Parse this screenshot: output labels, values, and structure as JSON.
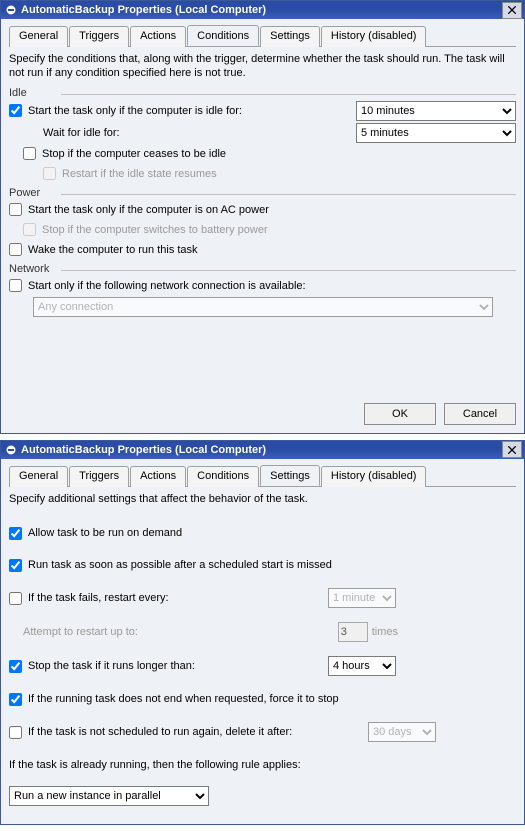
{
  "window1": {
    "title": "AutomaticBackup Properties (Local Computer)",
    "tabs": [
      "General",
      "Triggers",
      "Actions",
      "Conditions",
      "Settings",
      "History (disabled)"
    ],
    "active_tab": "Conditions",
    "intro": "Specify the conditions that, along with the trigger, determine whether the task should run.  The task will not run  if any condition specified here is not true.",
    "idle": {
      "group": "Idle",
      "start_idle": "Start the task only if the computer is idle for:",
      "start_idle_value": "10 minutes",
      "wait_idle": "Wait for idle for:",
      "wait_idle_value": "5 minutes",
      "stop_cease": "Stop if the computer ceases to be idle",
      "restart_resume": "Restart if the idle state resumes"
    },
    "power": {
      "group": "Power",
      "ac": "Start the task only if the computer is on AC power",
      "stop_batt": "Stop if the computer switches to battery power",
      "wake": "Wake the computer to run this task"
    },
    "network": {
      "group": "Network",
      "start_net": "Start only if the following network connection is available:",
      "any": "Any connection"
    },
    "buttons": {
      "ok": "OK",
      "cancel": "Cancel"
    }
  },
  "window2": {
    "title": "AutomaticBackup Properties (Local Computer)",
    "tabs": [
      "General",
      "Triggers",
      "Actions",
      "Conditions",
      "Settings",
      "History (disabled)"
    ],
    "active_tab": "Settings",
    "intro": "Specify additional settings that affect the behavior of the task.",
    "s": {
      "allow_demand": "Allow task to be run on demand",
      "run_asap": "Run task as soon as possible after a scheduled start is missed",
      "fail_restart": "If the task fails, restart every:",
      "fail_restart_value": "1 minute",
      "attempt": "Attempt to restart up to:",
      "attempt_value": "3",
      "attempt_suffix": "times",
      "stop_long": "Stop the task if it runs longer than:",
      "stop_long_value": "4 hours",
      "force_stop": "If the running task does not end when requested, force it to stop",
      "delete_after": "If the task is not scheduled to run again, delete it after:",
      "delete_after_value": "30 days",
      "already_running": "If the task is already running, then the following rule applies:",
      "rule_value": "Run a new instance in parallel"
    }
  }
}
